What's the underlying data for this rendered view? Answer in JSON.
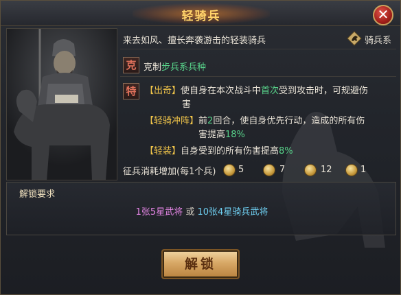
{
  "window": {
    "title": "轻骑兵",
    "close_label": "✕"
  },
  "unit": {
    "description": "来去如风、擅长奔袭游击的轻装骑兵",
    "type_icon": "cavalry-type-icon",
    "type_label": "骑兵系"
  },
  "counter": {
    "badge": "克",
    "prefix": "克制",
    "target": "步兵系兵种"
  },
  "traits": {
    "badge": "特",
    "items": [
      {
        "name": "【出奇】",
        "parts": [
          "使自身在本次战斗中",
          "首次",
          "受到攻击时，可规避伤",
          "害"
        ]
      },
      {
        "name": "【轻骑冲阵】",
        "parts": [
          "前",
          "2",
          "回合，使自身优先行动，造成的所有伤",
          "害提高",
          "18%"
        ]
      },
      {
        "name": "【轻装】",
        "parts": [
          "自身受到的所有伤害提高",
          "8%"
        ]
      }
    ]
  },
  "cost": {
    "label": "征兵消耗增加",
    "note": "(每1个兵)",
    "items": [
      {
        "icon": "food-icon",
        "value": "5"
      },
      {
        "icon": "wood-icon",
        "value": "7"
      },
      {
        "icon": "iron-icon",
        "value": "12"
      },
      {
        "icon": "copper-coin-icon",
        "value": "1"
      }
    ]
  },
  "unlock": {
    "title": "解锁要求",
    "option_1": "1张5星武将",
    "connector": "或",
    "option_2": "10张4星骑兵武将",
    "button_label": "解锁"
  },
  "colors": {
    "title": "#ffd36a",
    "highlight_green": "#58d38a",
    "trait_name": "#f2c64a",
    "req_pink": "#e586e6",
    "req_cyan": "#6fd0f2"
  }
}
